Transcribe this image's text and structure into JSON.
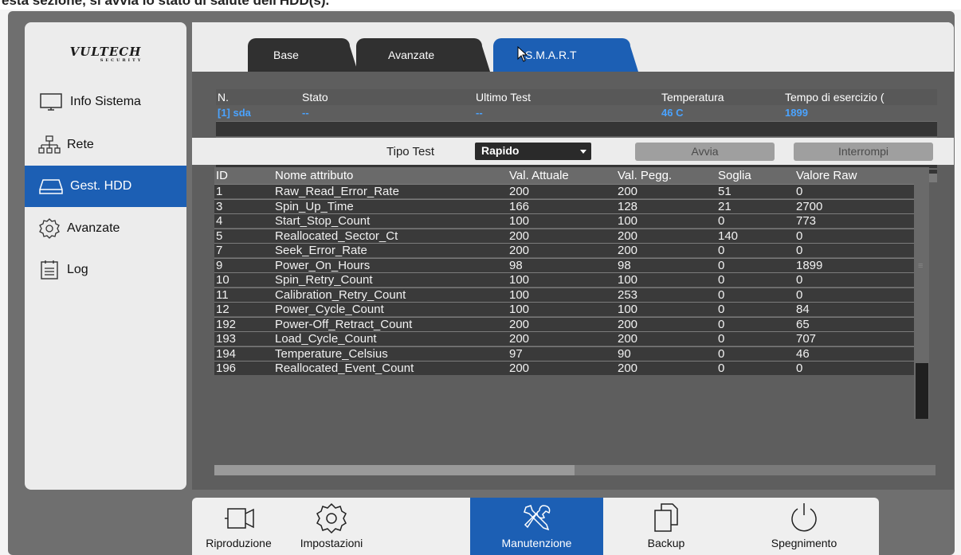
{
  "caption": "esta sezione, si avvia lo stato di salute dell'HDD(s).",
  "logo": {
    "brand": "VULTECH",
    "sub": "SECURITY"
  },
  "sidebar": {
    "items": [
      {
        "label": "Info Sistema",
        "icon": "monitor-icon"
      },
      {
        "label": "Rete",
        "icon": "network-icon"
      },
      {
        "label": "Gest. HDD",
        "icon": "hdd-icon",
        "active": true
      },
      {
        "label": "Avanzate",
        "icon": "gear-icon"
      },
      {
        "label": "Log",
        "icon": "log-icon"
      }
    ]
  },
  "tabs": [
    {
      "label": "Base"
    },
    {
      "label": "Avanzate"
    },
    {
      "label": "S.M.A.R.T",
      "active": true
    }
  ],
  "hdd_table": {
    "headers": [
      "N.",
      "Stato",
      "Ultimo Test",
      "Temperatura",
      "Tempo di esercizio ("
    ],
    "rows": [
      {
        "n": "[1] sda",
        "stato": "--",
        "ultimo": "--",
        "temp": "46 C",
        "tempo": "1899"
      }
    ]
  },
  "test": {
    "label": "Tipo Test",
    "selected": "Rapido",
    "start": "Avvia",
    "stop": "Interrompi"
  },
  "attributes": {
    "headers": [
      "ID",
      "Nome attributo",
      "Val. Attuale",
      "Val. Pegg.",
      "Soglia",
      "Valore Raw"
    ],
    "rows": [
      [
        "1",
        "Raw_Read_Error_Rate",
        "200",
        "200",
        "51",
        "0"
      ],
      [
        "3",
        "Spin_Up_Time",
        "166",
        "128",
        "21",
        "2700"
      ],
      [
        "4",
        "Start_Stop_Count",
        "100",
        "100",
        "0",
        "773"
      ],
      [
        "5",
        "Reallocated_Sector_Ct",
        "200",
        "200",
        "140",
        "0"
      ],
      [
        "7",
        "Seek_Error_Rate",
        "200",
        "200",
        "0",
        "0"
      ],
      [
        "9",
        "Power_On_Hours",
        "98",
        "98",
        "0",
        "1899"
      ],
      [
        "10",
        "Spin_Retry_Count",
        "100",
        "100",
        "0",
        "0"
      ],
      [
        "11",
        "Calibration_Retry_Count",
        "100",
        "253",
        "0",
        "0"
      ],
      [
        "12",
        "Power_Cycle_Count",
        "100",
        "100",
        "0",
        "84"
      ],
      [
        "192",
        "Power-Off_Retract_Count",
        "200",
        "200",
        "0",
        "65"
      ],
      [
        "193",
        "Load_Cycle_Count",
        "200",
        "200",
        "0",
        "707"
      ],
      [
        "194",
        "Temperature_Celsius",
        "97",
        "90",
        "0",
        "46"
      ],
      [
        "196",
        "Reallocated_Event_Count",
        "200",
        "200",
        "0",
        "0"
      ]
    ]
  },
  "taskbar": [
    {
      "label": "Riproduzione",
      "icon": "camera-icon"
    },
    {
      "label": "Impostazioni",
      "icon": "gear-icon"
    },
    {
      "label": "Manutenzione",
      "icon": "tools-icon",
      "active": true
    },
    {
      "label": "Backup",
      "icon": "copy-icon"
    },
    {
      "label": "Spegnimento",
      "icon": "power-icon"
    }
  ],
  "colors": {
    "accent": "#1c5fb4",
    "highlight_text": "#4aa3ff"
  }
}
